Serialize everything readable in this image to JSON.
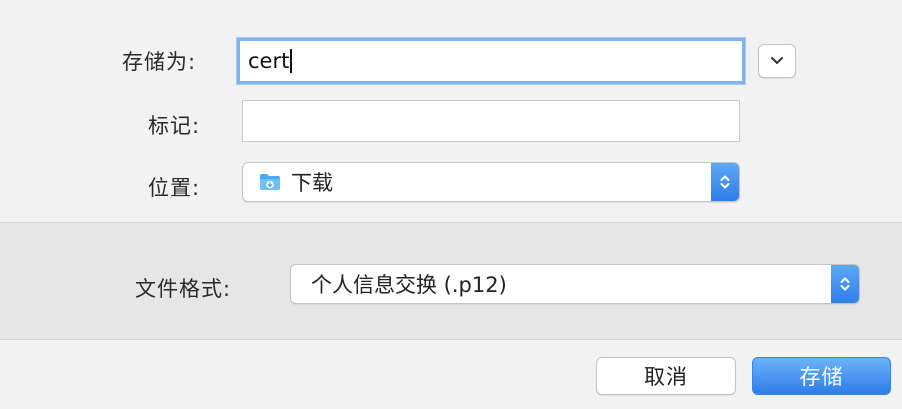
{
  "form": {
    "save_as_label": "存储为:",
    "save_as_value": "cert",
    "tags_label": "标记:",
    "tags_value": "",
    "location_label": "位置:",
    "location_value": "下载",
    "location_icon": "downloads-folder-icon"
  },
  "format": {
    "label": "文件格式:",
    "value": "个人信息交换 (.p12)"
  },
  "buttons": {
    "cancel": "取消",
    "save": "存储"
  },
  "colors": {
    "accent": "#2f7fe8",
    "focus_ring": "#7fb2f0"
  }
}
